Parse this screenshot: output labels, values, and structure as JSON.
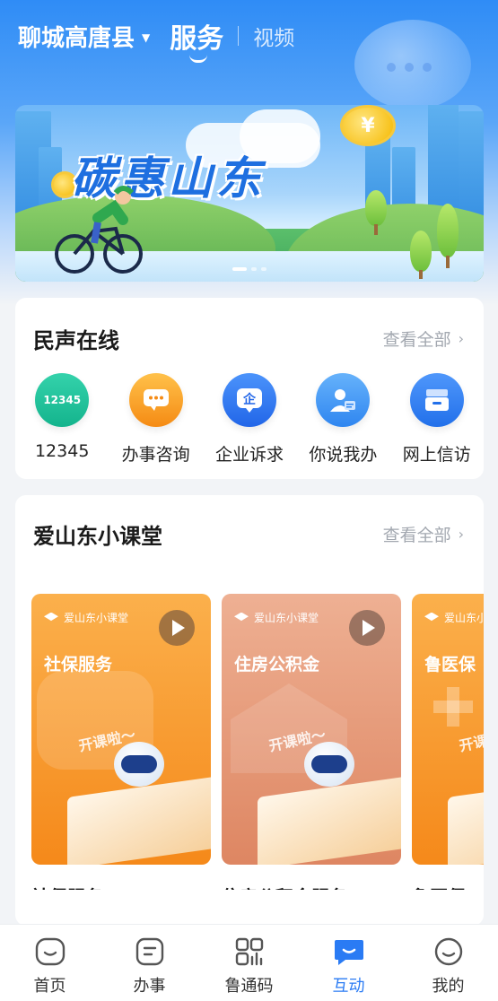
{
  "header": {
    "city": "聊城高唐县",
    "tab_service": "服务",
    "tab_video": "视频"
  },
  "banner": {
    "title": "碳惠山东",
    "coin_symbol": "¥",
    "slide_count": 3,
    "active_slide": 1
  },
  "voice": {
    "title": "民声在线",
    "see_all": "查看全部",
    "items": [
      {
        "label": "12345",
        "icon": "hotline-12345-icon",
        "icon_text": "12345",
        "color": "#1fbf9a"
      },
      {
        "label": "办事咨询",
        "icon": "chat-bubble-icon",
        "icon_text": "···",
        "color": "#f7a21b"
      },
      {
        "label": "企业诉求",
        "icon": "enterprise-icon",
        "icon_text": "企",
        "color": "#2a7bf4"
      },
      {
        "label": "你说我办",
        "icon": "person-card-icon",
        "icon_text": "",
        "color": "#3b92f7"
      },
      {
        "label": "网上信访",
        "icon": "inbox-icon",
        "icon_text": "",
        "color": "#2f7ef2"
      }
    ]
  },
  "classroom": {
    "title": "爱山东小课堂",
    "see_all": "查看全部",
    "tag": "爱山东小课堂",
    "kaike": "开课啦～",
    "courses": [
      {
        "thumb_title": "社保服务",
        "name": "社保服务",
        "color_top": "#f9a640",
        "color_bottom": "#f58b1f"
      },
      {
        "thumb_title": "住房公积金",
        "name": "住房公积金服务...",
        "color_top": "#eaa98a",
        "color_bottom": "#e08865"
      },
      {
        "thumb_title": "鲁医保",
        "name": "鲁医保",
        "color_top": "#f9a640",
        "color_bottom": "#f58b1f"
      }
    ]
  },
  "tabbar": {
    "items": [
      {
        "label": "首页",
        "icon": "home-icon"
      },
      {
        "label": "办事",
        "icon": "tasks-icon"
      },
      {
        "label": "鲁通码",
        "icon": "qr-code-icon"
      },
      {
        "label": "互动",
        "icon": "interaction-icon"
      },
      {
        "label": "我的",
        "icon": "profile-icon"
      }
    ],
    "active": "互动"
  },
  "colors": {
    "accent": "#2a7bf4",
    "header_bg": "#2f8cf6"
  }
}
